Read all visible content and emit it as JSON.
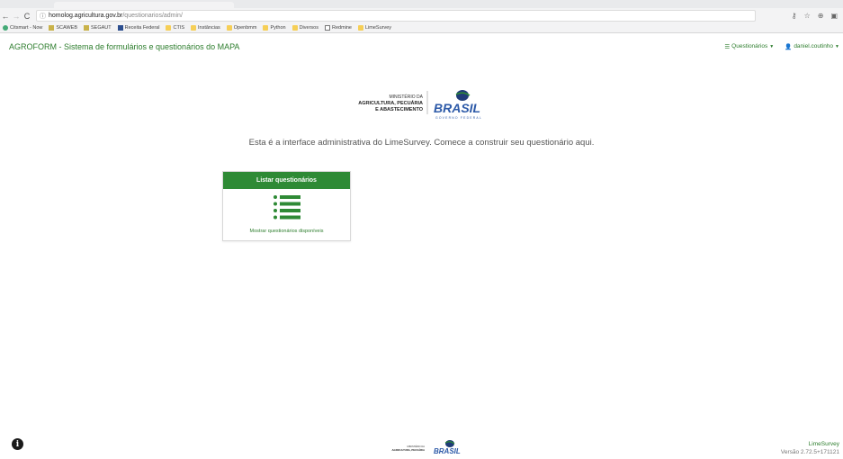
{
  "browser": {
    "url_host": "homolog.agricultura.gov.br",
    "url_path": "/questionarios/admin/",
    "bookmarks": [
      {
        "label": "Citsmart - Now",
        "icon": "citsmart-icon"
      },
      {
        "label": "SCAWEB",
        "icon": "scaweb-icon"
      },
      {
        "label": "SEGAUT",
        "icon": "segaut-icon"
      },
      {
        "label": "Receita Federal",
        "icon": "receita-icon"
      },
      {
        "label": "CTIS",
        "icon": "folder-icon"
      },
      {
        "label": "Instâncias",
        "icon": "folder-icon"
      },
      {
        "label": "Openbmm",
        "icon": "folder-icon"
      },
      {
        "label": "Python",
        "icon": "folder-icon"
      },
      {
        "label": "Diversos",
        "icon": "folder-icon"
      },
      {
        "label": "Redmine",
        "icon": "page-icon"
      },
      {
        "label": "LimeSurvey",
        "icon": "folder-icon"
      }
    ]
  },
  "navbar": {
    "brand": "AGROFORM - Sistema de formulários e questionários do MAPA",
    "surveys_menu": "Questionários",
    "user_menu": "daniel.coutinho"
  },
  "logo": {
    "line1": "MINISTÉRIO DA",
    "line2": "AGRICULTURA, PECUÁRIA",
    "line3": "E ABASTECIMENTO",
    "brasil": "BRASIL",
    "gov": "GOVERNO FEDERAL"
  },
  "main": {
    "tagline": "Esta é a interface administrativa do LimeSurvey. Comece a construir seu questionário aqui."
  },
  "card": {
    "title": "Listar questionários",
    "footer": "Mostrar questionários disponíveis",
    "accent": "#2e8a35"
  },
  "footer": {
    "product": "LimeSurvey",
    "version": "Versão 2.72.5+171121"
  }
}
